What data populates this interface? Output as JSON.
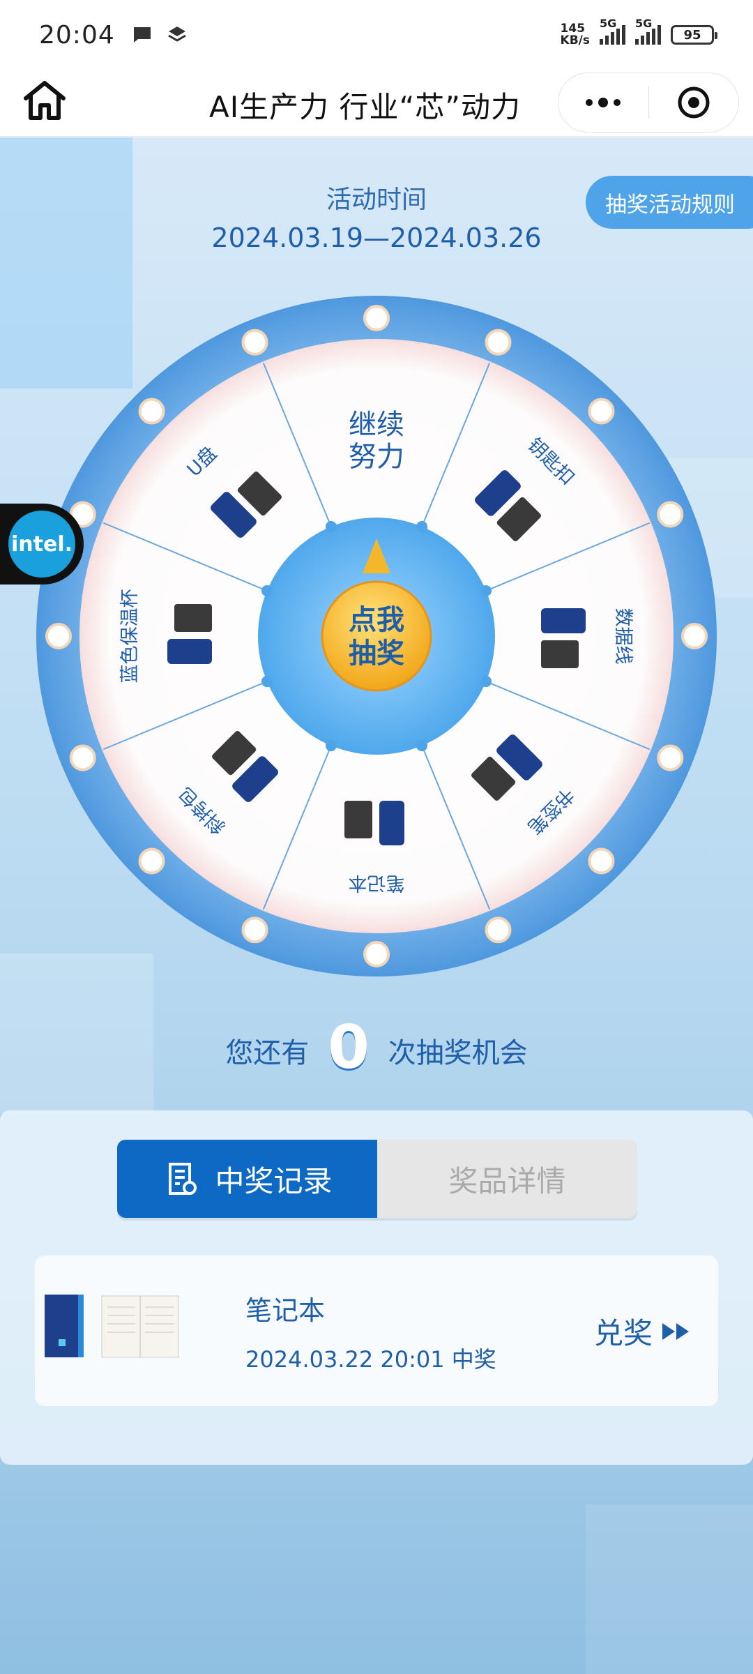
{
  "status": {
    "time": "20:04",
    "net_speed_value": "145",
    "net_speed_unit": "KB/s",
    "sim1": "5G",
    "sim2": "5G",
    "battery": "95"
  },
  "nav": {
    "title": "AI生产力 行业“芯”动力"
  },
  "activity": {
    "label": "活动时间",
    "dates": "2024.03.19—2024.03.26",
    "rules_button": "抽奖活动规则"
  },
  "wheel": {
    "center_line1": "点我",
    "center_line2": "抽奖",
    "segments": [
      {
        "label_line1": "继续",
        "label_line2": "努力"
      },
      {
        "label_line1": "钥匙扣"
      },
      {
        "label_line1": "数据线"
      },
      {
        "label_line1": "书签笔"
      },
      {
        "label_line1": "笔记本"
      },
      {
        "label_line1": "斜挎包"
      },
      {
        "label_line1": "蓝色保温杯"
      },
      {
        "label_line1": "U盘"
      }
    ]
  },
  "intel_badge": "intel.",
  "chances": {
    "prefix": "您还有",
    "count": "0",
    "suffix": "次抽奖机会"
  },
  "tabs": {
    "records": "中奖记录",
    "prize_details": "奖品详情"
  },
  "record": {
    "prize_name": "笔记本",
    "time_text": "2024.03.22 20:01 中奖",
    "redeem_label": "兑奖"
  },
  "colors": {
    "accent": "#0d69c4",
    "text_blue": "#1f5ea8",
    "wheel_ring": "#5aa2e4",
    "center_button": "#f5b82a"
  },
  "icons": [
    "home-icon",
    "more-icon",
    "target-icon",
    "notes-icon",
    "record-list-icon",
    "double-play-icon",
    "message-icon",
    "layers-icon"
  ]
}
